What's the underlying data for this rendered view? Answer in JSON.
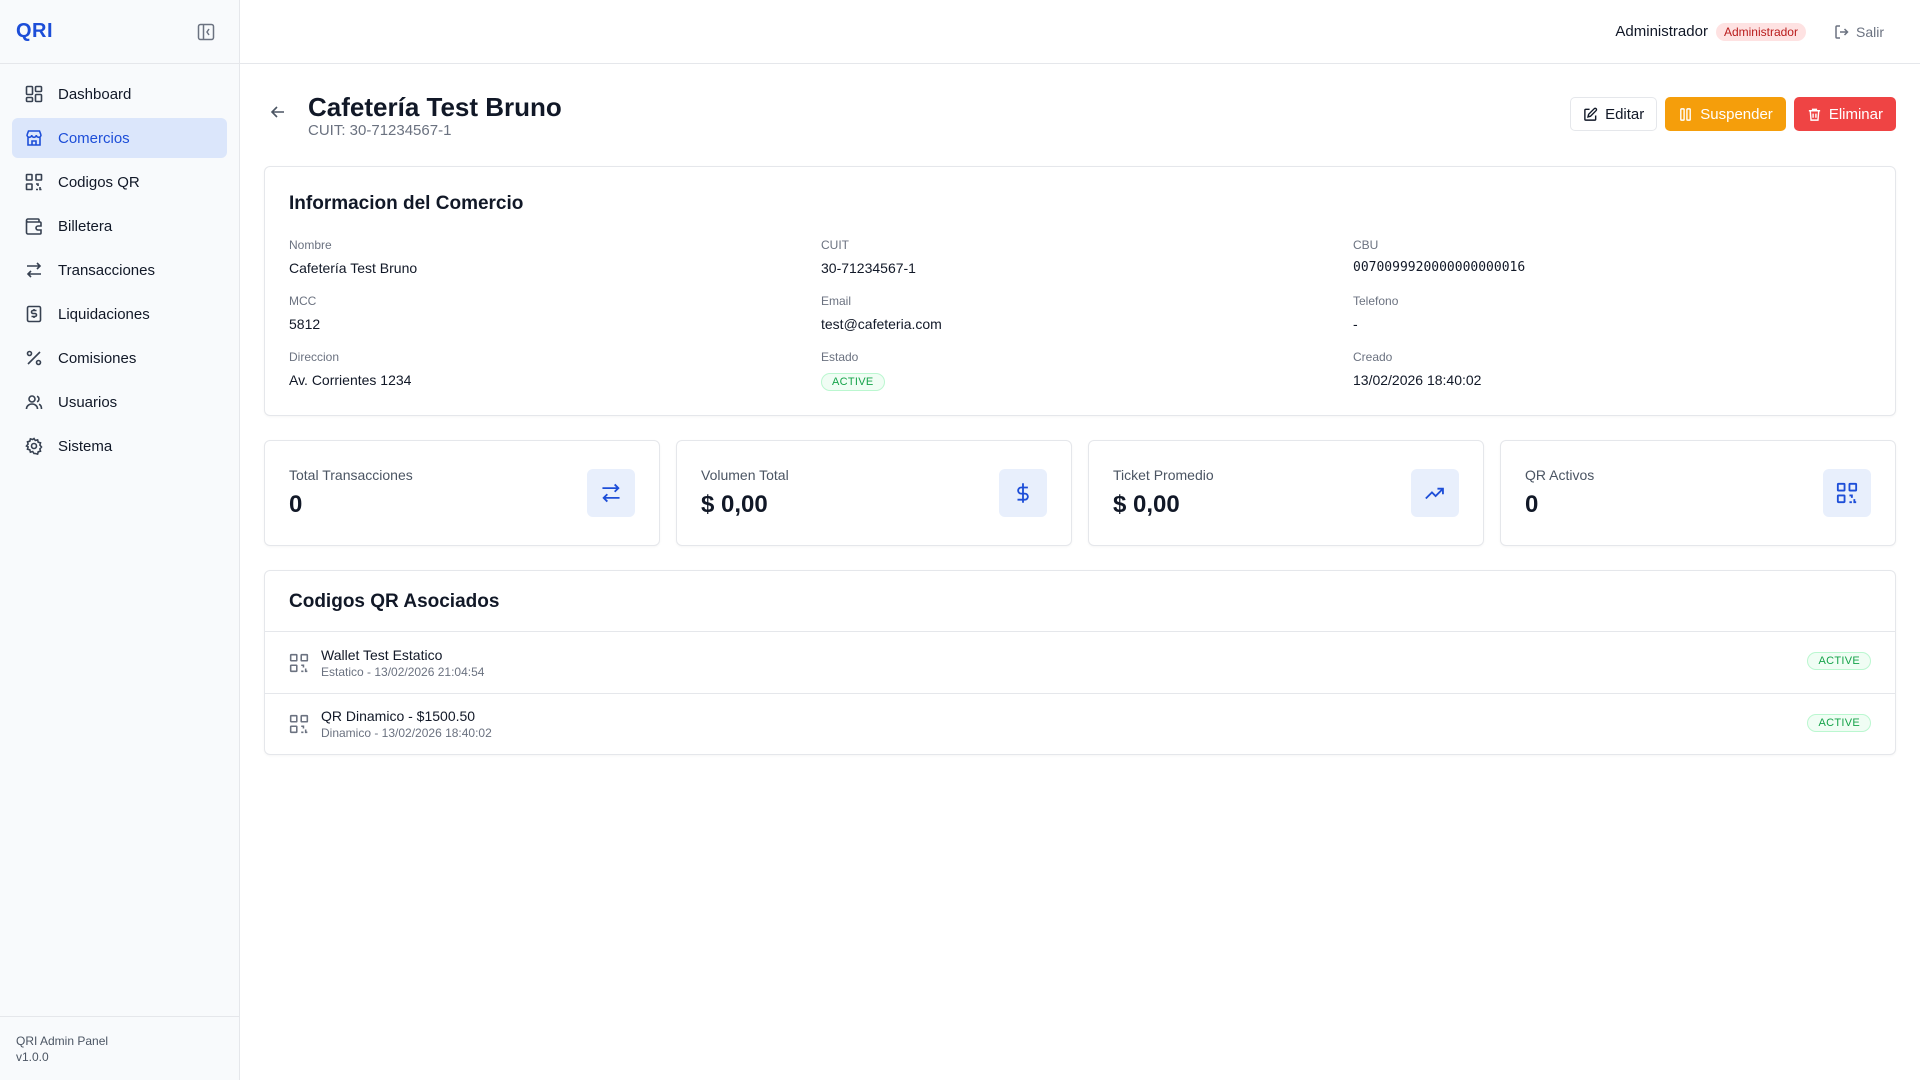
{
  "app": {
    "logo": "QRI",
    "footer_line1": "QRI Admin Panel",
    "footer_line2": "v1.0.0"
  },
  "sidebar": {
    "items": [
      {
        "label": "Dashboard",
        "icon": "dashboard-icon"
      },
      {
        "label": "Comercios",
        "icon": "store-icon",
        "active": true
      },
      {
        "label": "Codigos QR",
        "icon": "qr-code-icon"
      },
      {
        "label": "Billetera",
        "icon": "wallet-icon"
      },
      {
        "label": "Transacciones",
        "icon": "transfer-icon"
      },
      {
        "label": "Liquidaciones",
        "icon": "receipt-icon"
      },
      {
        "label": "Comisiones",
        "icon": "percent-icon"
      },
      {
        "label": "Usuarios",
        "icon": "users-icon"
      },
      {
        "label": "Sistema",
        "icon": "gear-icon"
      }
    ]
  },
  "topbar": {
    "user": "Administrador",
    "role": "Administrador",
    "logout": "Salir"
  },
  "page": {
    "title": "Cafetería Test Bruno",
    "subtitle": "CUIT: 30-71234567-1",
    "actions": {
      "edit": "Editar",
      "suspend": "Suspender",
      "delete": "Eliminar"
    }
  },
  "info": {
    "title": "Informacion del Comercio",
    "nombre_label": "Nombre",
    "nombre": "Cafetería Test Bruno",
    "cuit_label": "CUIT",
    "cuit": "30-71234567-1",
    "cbu_label": "CBU",
    "cbu": "0070099920000000000016",
    "mcc_label": "MCC",
    "mcc": "5812",
    "email_label": "Email",
    "email": "test@cafeteria.com",
    "telefono_label": "Telefono",
    "telefono": "-",
    "direccion_label": "Direccion",
    "direccion": "Av. Corrientes 1234",
    "estado_label": "Estado",
    "estado": "ACTIVE",
    "creado_label": "Creado",
    "creado": "13/02/2026 18:40:02"
  },
  "stats": [
    {
      "label": "Total Transacciones",
      "value": "0",
      "icon": "transfer-icon"
    },
    {
      "label": "Volumen Total",
      "value": "$ 0,00",
      "icon": "dollar-icon"
    },
    {
      "label": "Ticket Promedio",
      "value": "$ 0,00",
      "icon": "trending-up-icon"
    },
    {
      "label": "QR Activos",
      "value": "0",
      "icon": "qr-code-icon"
    }
  ],
  "qr": {
    "title": "Codigos QR Asociados",
    "items": [
      {
        "name": "Wallet Test Estatico",
        "meta": "Estatico - 13/02/2026 21:04:54",
        "status": "ACTIVE"
      },
      {
        "name": "QR Dinamico - $1500.50",
        "meta": "Dinamico - 13/02/2026 18:40:02",
        "status": "ACTIVE"
      }
    ]
  },
  "colors": {
    "accent": "#1d4ed8",
    "warning": "#f59e0b",
    "danger": "#ef4444",
    "success": "#16a34a"
  }
}
